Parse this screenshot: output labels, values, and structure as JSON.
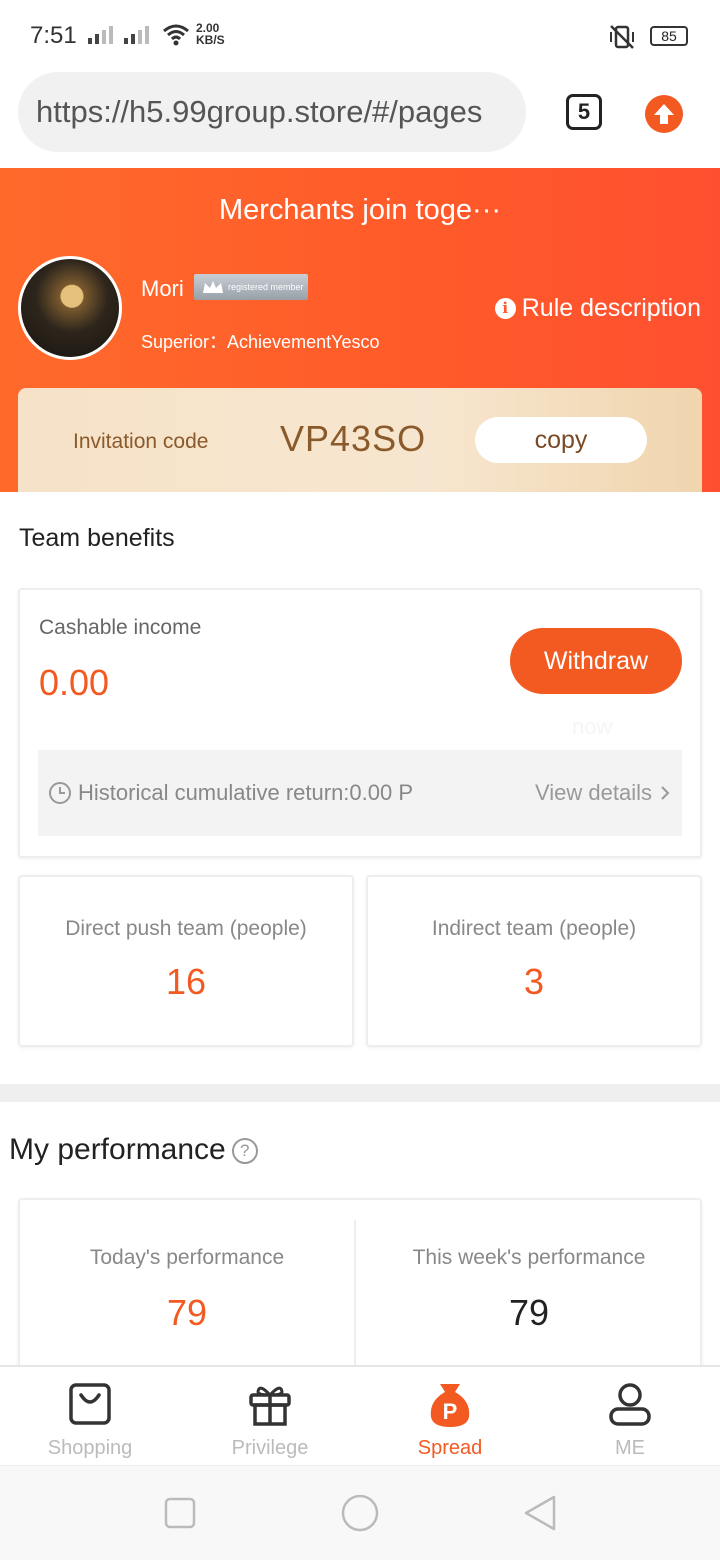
{
  "status_bar": {
    "time": "7:51",
    "speed_value": "2.00",
    "speed_unit": "KB/S",
    "battery": "85"
  },
  "browser": {
    "url": "https://h5.99group.store/#/pages",
    "tab_count": "5"
  },
  "header": {
    "title": "Merchants join toge···",
    "user_name": "Mori",
    "member_badge": "registered member",
    "superior": "Superior：AchievementYesco",
    "rule_label": "Rule description",
    "invitation_label": "Invitation code",
    "invitation_code": "VP43SO",
    "copy_label": "copy"
  },
  "team_benefits": {
    "title": "Team benefits",
    "income_label": "Cashable income",
    "income_value": "0.00",
    "withdraw_label": "Withdraw",
    "withdraw_faded": "now",
    "history_text": "Historical cumulative return:0.00 P",
    "view_details": "View details",
    "direct_label": "Direct push team (people)",
    "direct_value": "16",
    "indirect_label": "Indirect team (people)",
    "indirect_value": "3"
  },
  "performance": {
    "title": "My performance",
    "help_glyph": "?",
    "today_label": "Today's performance",
    "today_value": "79",
    "week_label": "This week's performance",
    "week_value": "79"
  },
  "bottom_nav": {
    "items": [
      {
        "label": "Shopping",
        "icon": "shopping-bag-icon"
      },
      {
        "label": "Privilege",
        "icon": "gift-icon"
      },
      {
        "label": "Spread",
        "icon": "money-bag-icon",
        "glyph": "P"
      },
      {
        "label": "ME",
        "icon": "person-icon"
      }
    ],
    "active_index": 2
  },
  "colors": {
    "accent": "#f25a22",
    "header_start": "#ff6a2b",
    "header_end": "#ff4f30",
    "invite_text": "#8a5a2a"
  }
}
